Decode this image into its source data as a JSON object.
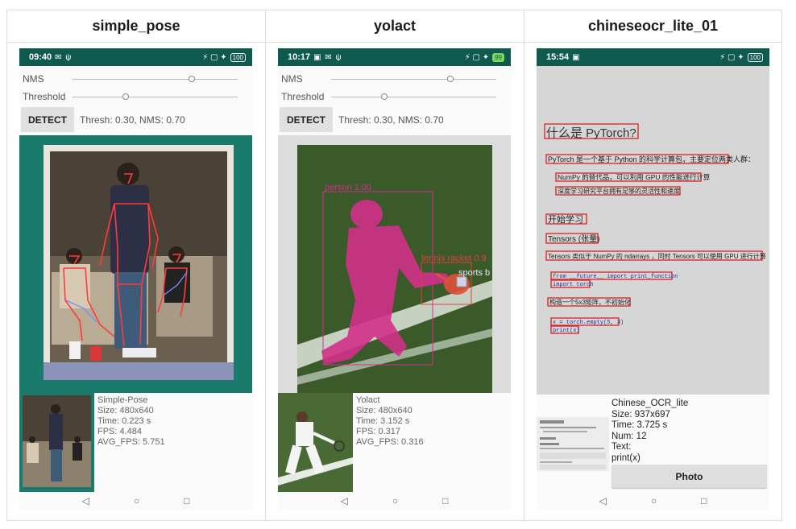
{
  "columns": [
    {
      "title": "simple_pose",
      "status": {
        "time": "09:40",
        "left_icons": "✉ ψ",
        "right_icons": "⚡ ▢ ✦",
        "battery": "100"
      },
      "controls": {
        "nms_label": "NMS",
        "threshold_label": "Threshold",
        "nms_value": 0.7,
        "threshold_value": 0.3
      },
      "detect_label": "DETECT",
      "thresh_text": "Thresh: 0.30, NMS: 0.70",
      "info": [
        "Simple-Pose",
        "Size: 480x640",
        "Time: 0.223 s",
        "FPS: 4.484",
        "AVG_FPS: 5.751"
      ]
    },
    {
      "title": "yolact",
      "status": {
        "time": "10:17",
        "left_icons": "▣ ✉ ψ",
        "right_icons": "⚡ ▢ ✦",
        "battery": "99"
      },
      "controls": {
        "nms_label": "NMS",
        "threshold_label": "Threshold",
        "nms_value": 0.7,
        "threshold_value": 0.3
      },
      "detect_label": "DETECT",
      "thresh_text": "Thresh: 0.30, NMS: 0.70",
      "labels": {
        "person": "person 1.00",
        "racket": "tennis racket 0.9",
        "ball": "sports b"
      },
      "info": [
        "Yolact",
        "Size: 480x640",
        "Time: 3.152 s",
        "FPS: 0.317",
        "AVG_FPS: 0.316"
      ]
    },
    {
      "title": "chineseocr_lite_01",
      "status": {
        "time": "15:54",
        "left_icons": "▣",
        "right_icons": "⚡ ▢ ✦",
        "battery": "100"
      },
      "ocr_lines": [
        "什么是 PyTorch?",
        "PyTorch 是一个基于 Python 的科学计算包，主要定位两类人群：",
        "NumPy 的替代品，可以利用 GPU 的性能进行计算",
        "深度学习研究平台拥有足够的灵活性和速度",
        "开始学习",
        "Tensors (张量)",
        "Tensors 类似于 NumPy 的 ndarrays ，同时 Tensors 可以使用 GPU 进行计算",
        "from __future__ import print_function",
        "import torch",
        "构造一个5x3矩阵，不初始化",
        "x = torch.empty(5, 3)",
        "print(x)"
      ],
      "info": [
        "Chinese_OCR_lite",
        "Size: 937x697",
        "Time: 3.725 s",
        "Num: 12",
        "Text:",
        "print(x)"
      ],
      "photo_label": "Photo"
    }
  ],
  "nav": {
    "back": "◁",
    "home": "○",
    "recent": "□"
  }
}
